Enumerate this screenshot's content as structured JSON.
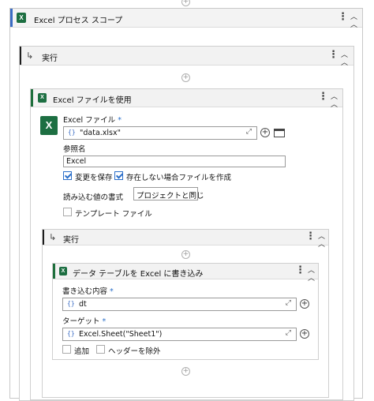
{
  "outer_scope": {
    "title": "Excel プロセス スコープ"
  },
  "do_outer": {
    "title": "実行"
  },
  "use_file": {
    "title": "Excel ファイルを使用",
    "file_label": "Excel ファイル",
    "file_value": "\"data.xlsx\"",
    "ref_label": "参照名",
    "ref_value": "Excel",
    "save_changes": {
      "label": "変更を保存",
      "checked": true
    },
    "create_if_missing": {
      "label": "存在しない場合ファイルを作成",
      "checked": true
    },
    "read_format_label": "読み込む値の書式",
    "read_format_value": "プロジェクトと同じ",
    "template": {
      "label": "テンプレート ファイル",
      "checked": false
    }
  },
  "do_inner": {
    "title": "実行"
  },
  "write_dt": {
    "title": "データ テーブルを Excel に書き込み",
    "content_label": "書き込む内容",
    "content_value": "dt",
    "target_label": "ターゲット",
    "target_value": "Excel.Sheet(\"Sheet1\")",
    "append": {
      "label": "追加",
      "checked": false
    },
    "exclude_headers": {
      "label": "ヘッダーを除外",
      "checked": false
    }
  },
  "required_mark": "*",
  "icons": [
    "plus-circle-icon",
    "excel-icon",
    "do-arrow-icon",
    "kebab-menu-icon",
    "collapse-icon",
    "expand-editor-icon",
    "folder-icon",
    "checkmark-icon",
    "chevron-down-icon"
  ]
}
